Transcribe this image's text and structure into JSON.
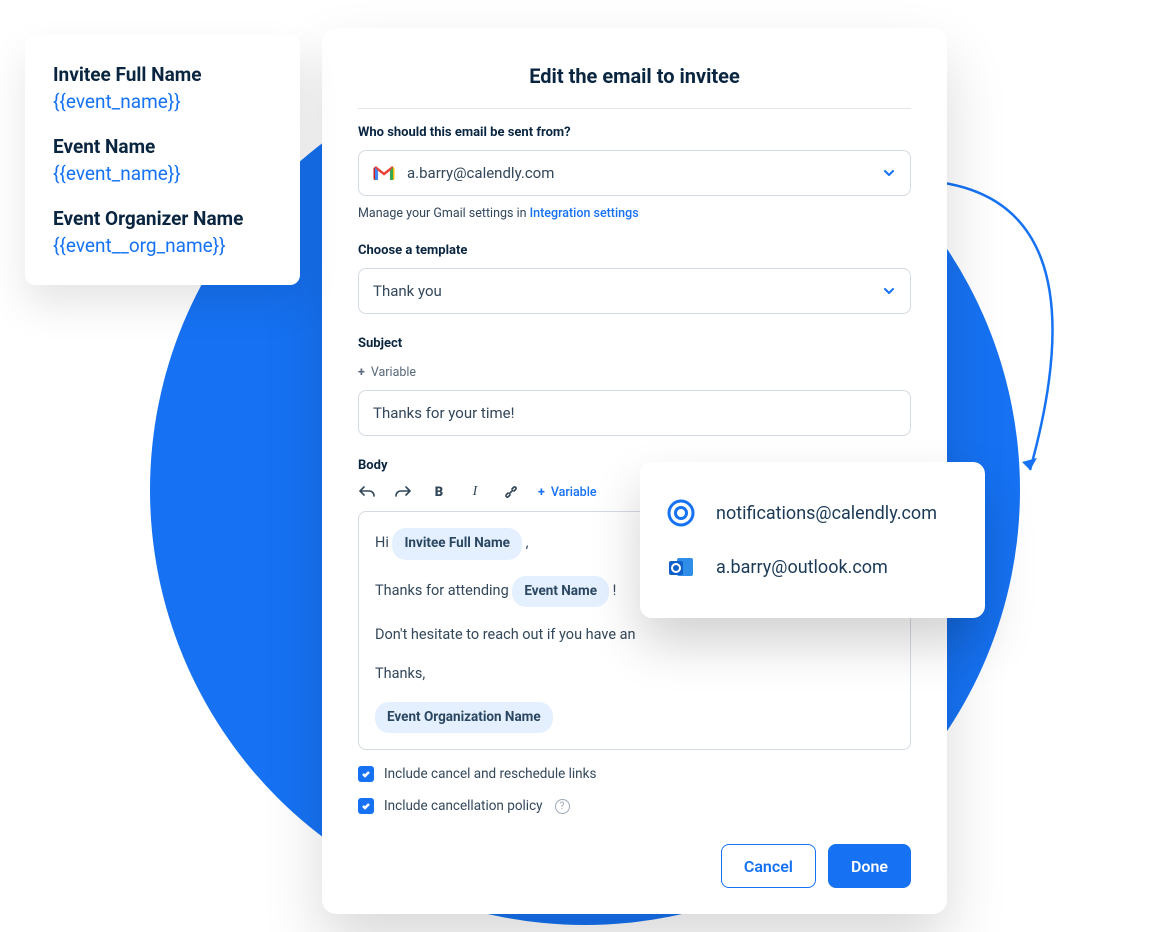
{
  "variables_card": {
    "rows": [
      {
        "label": "Invitee Full Name",
        "token": "{{event_name}}"
      },
      {
        "label": "Event Name",
        "token": "{{event_name}}"
      },
      {
        "label": "Event Organizer Name",
        "token": "{{event__org_name}}"
      }
    ]
  },
  "modal": {
    "title": "Edit the email to invitee",
    "sender": {
      "label": "Who should this email be sent from?",
      "selected": "a.barry@calendly.com",
      "helper_prefix": "Manage your Gmail settings in ",
      "helper_link": "Integration settings"
    },
    "template": {
      "label": "Choose a template",
      "selected": "Thank you"
    },
    "subject": {
      "label": "Subject",
      "add_variable": "Variable",
      "value": "Thanks for your time!"
    },
    "body": {
      "label": "Body",
      "toolbar_variable": "Variable",
      "line1_prefix": "Hi ",
      "line1_chip": "Invitee Full Name",
      "line1_suffix": " ,",
      "line2_prefix": "Thanks for attending ",
      "line2_chip": "Event Name",
      "line2_suffix": " !",
      "line3": "Don't hesitate to reach out if you have an",
      "line4": "Thanks,",
      "line5_chip": "Event Organization Name"
    },
    "options": {
      "include_cancel": "Include cancel and reschedule links",
      "include_policy": "Include cancellation policy"
    },
    "footer": {
      "cancel": "Cancel",
      "done": "Done"
    }
  },
  "sender_dropdown": {
    "options": [
      {
        "provider": "calendly",
        "email": "notifications@calendly.com"
      },
      {
        "provider": "outlook",
        "email": "a.barry@outlook.com"
      }
    ]
  }
}
